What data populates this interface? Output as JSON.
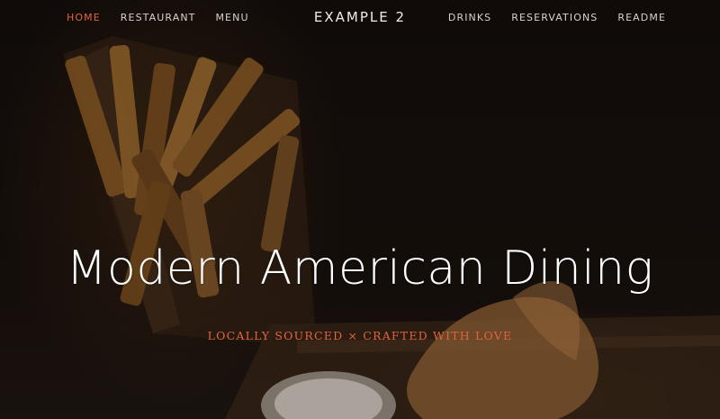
{
  "nav": {
    "left": [
      {
        "label": "HOME",
        "active": true
      },
      {
        "label": "RESTAURANT",
        "active": false
      },
      {
        "label": "MENU",
        "active": false
      }
    ],
    "brand": "EXAMPLE 2",
    "right": [
      {
        "label": "DRINKS",
        "active": false
      },
      {
        "label": "RESERVATIONS",
        "active": false
      },
      {
        "label": "README",
        "active": false
      }
    ]
  },
  "hero": {
    "headline": "Modern American Dining",
    "tagline": "LOCALLY SOURCED × CRAFTED WITH LOVE",
    "background_icon": "food-photo-fries-and-fish-icon"
  },
  "colors": {
    "accent": "#e2643f",
    "nav_text": "#d8d2cc",
    "background": "#130f0c",
    "headline": "#ffffff"
  }
}
